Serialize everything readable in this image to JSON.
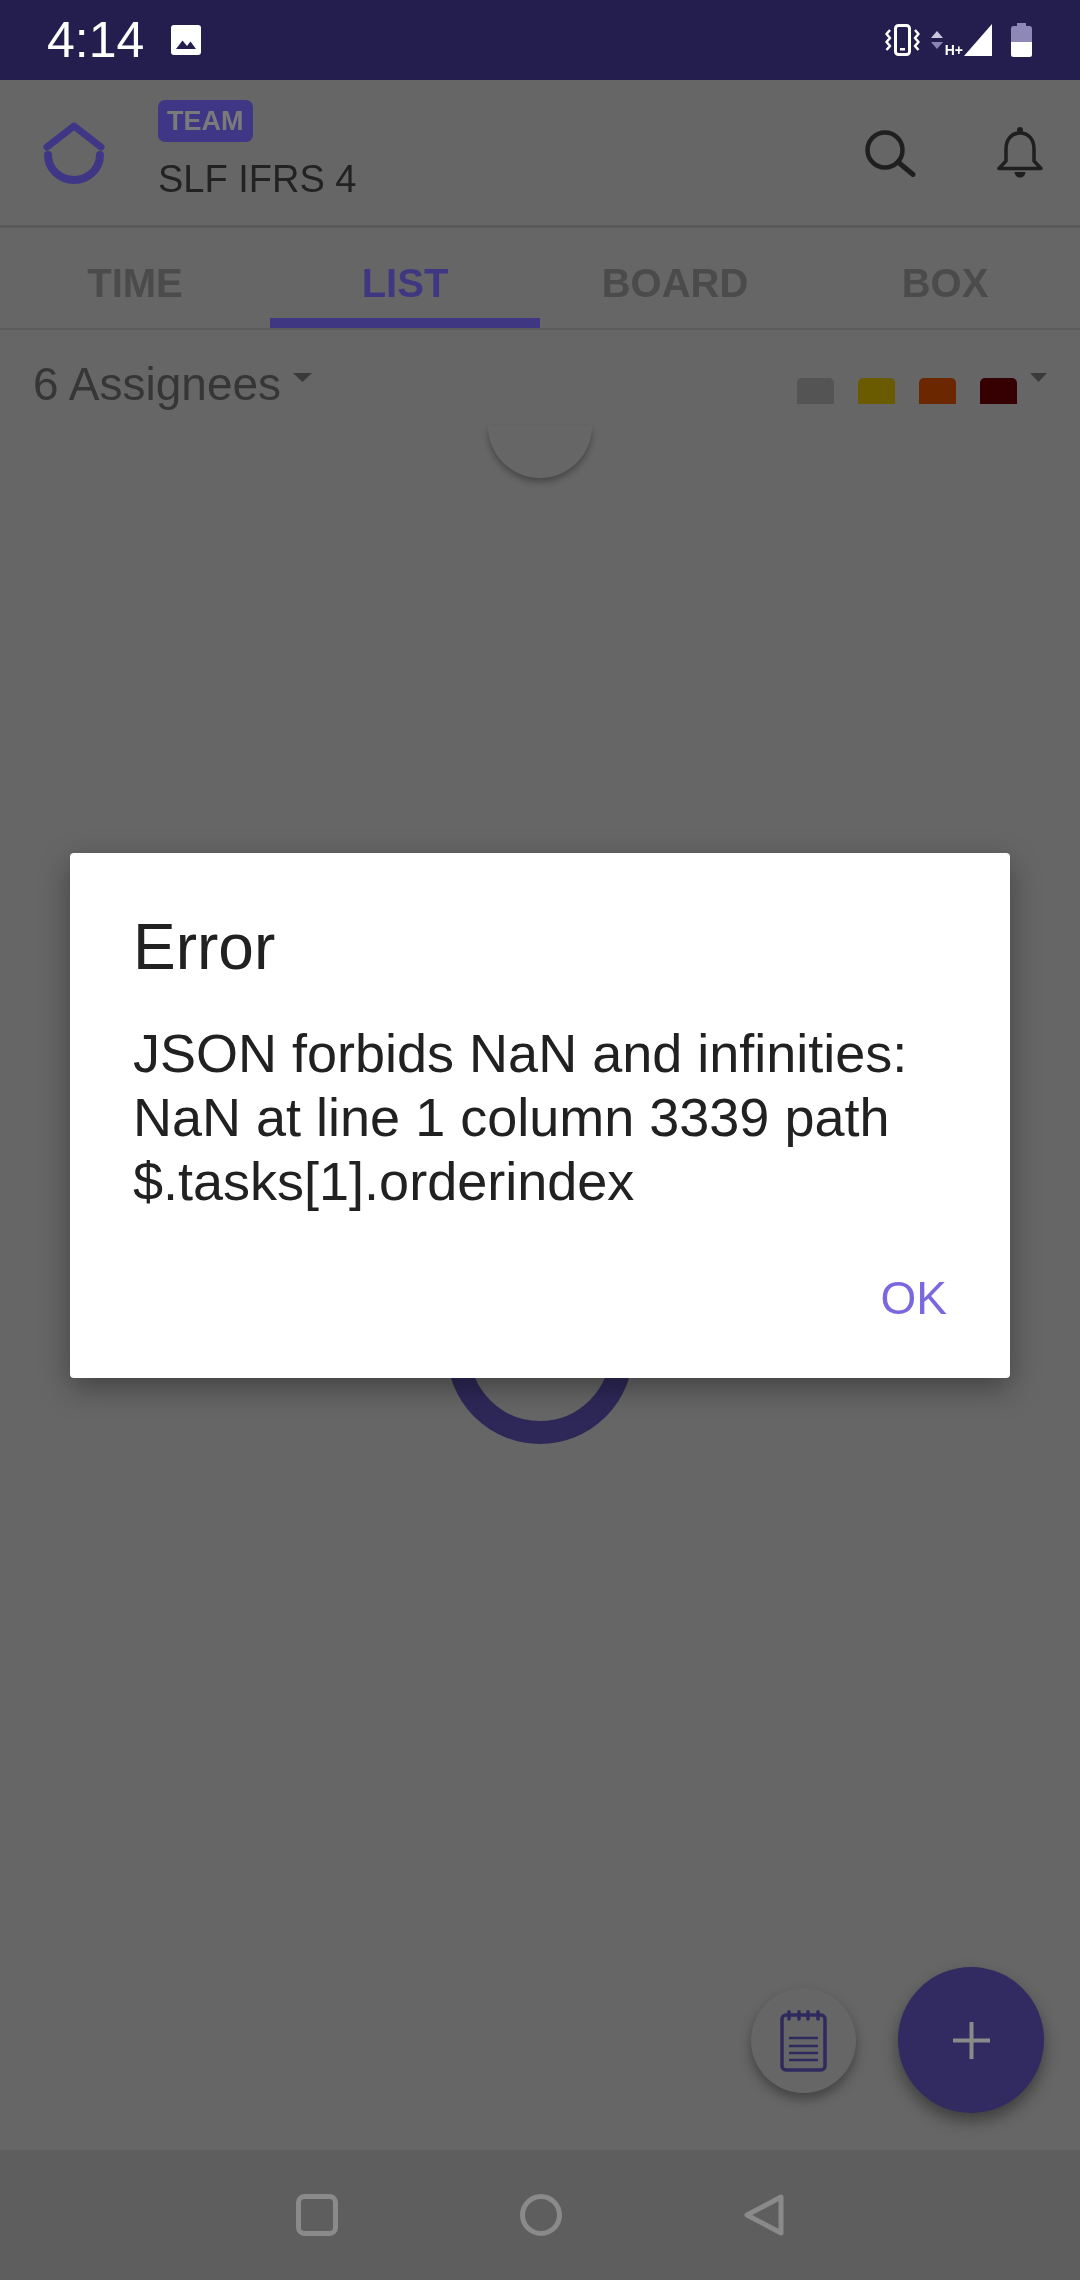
{
  "status_bar": {
    "time": "4:14",
    "network_type": "H+"
  },
  "app_bar": {
    "badge": "TEAM",
    "title": "SLF IFRS 4"
  },
  "tabs": [
    {
      "label": "TIME",
      "selected": false
    },
    {
      "label": "LIST",
      "selected": true
    },
    {
      "label": "BOARD",
      "selected": false
    },
    {
      "label": "BOX",
      "selected": false
    }
  ],
  "filter_bar": {
    "assignees": "6 Assignees",
    "color_filters": [
      {
        "color": "#545454"
      },
      {
        "color": "#6a5a00"
      },
      {
        "color": "#6b2700"
      },
      {
        "color": "#360003"
      }
    ]
  },
  "dialog": {
    "title": "Error",
    "message": "JSON forbids NaN and infinities: NaN at line 1 column 3339 path $.tasks[1].orderindex",
    "buttons": [
      "OK"
    ]
  }
}
